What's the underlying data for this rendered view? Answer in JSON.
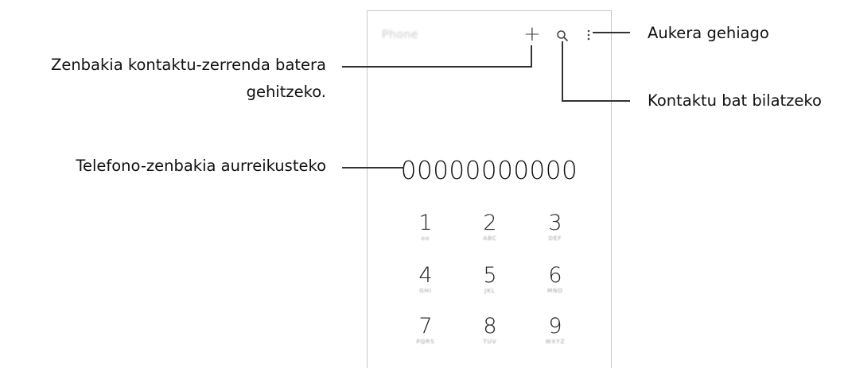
{
  "app": {
    "title": "Phone"
  },
  "dialer": {
    "number": "00000000000",
    "keys": [
      {
        "digit": "1",
        "sub": "oo"
      },
      {
        "digit": "2",
        "sub": "ABC"
      },
      {
        "digit": "3",
        "sub": "DEF"
      },
      {
        "digit": "4",
        "sub": "GHI"
      },
      {
        "digit": "5",
        "sub": "JKL"
      },
      {
        "digit": "6",
        "sub": "MNO"
      },
      {
        "digit": "7",
        "sub": "PQRS"
      },
      {
        "digit": "8",
        "sub": "TUV"
      },
      {
        "digit": "9",
        "sub": "WXYZ"
      }
    ]
  },
  "icons": {
    "add": "plus-icon",
    "search": "search-icon",
    "more": "more-options-icon"
  },
  "callouts": {
    "more_options": "Aukera gehiago",
    "add_contact_line1": "Zenbakia kontaktu-zerrenda batera",
    "add_contact_line2": "gehitzeko.",
    "search_contact": "Kontaktu bat bilatzeko",
    "preview_number": "Telefono-zenbakia aurreikusteko"
  }
}
